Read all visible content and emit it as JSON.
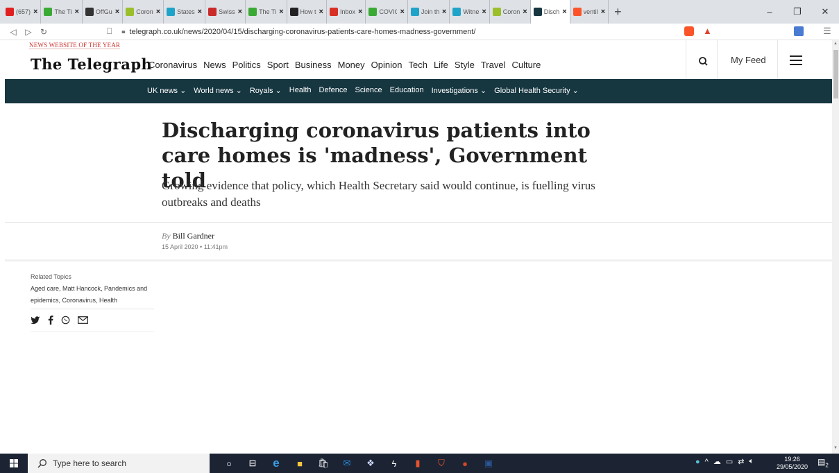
{
  "browser": {
    "tabs": [
      {
        "title": "(657)",
        "icon": "youtube-icon",
        "color": "#e02020"
      },
      {
        "title": "The Ti",
        "icon": "globe-icon",
        "color": "#3aaa35"
      },
      {
        "title": "OffGu",
        "icon": "offguardian-icon",
        "color": "#333333"
      },
      {
        "title": "Coron",
        "icon": "ugtv-icon",
        "color": "#9bbf2a"
      },
      {
        "title": "States",
        "icon": "c-icon",
        "color": "#1fa3c8"
      },
      {
        "title": "Swiss",
        "icon": "swiss-icon",
        "color": "#c92a2a"
      },
      {
        "title": "The Ti",
        "icon": "globe-icon",
        "color": "#3aaa35"
      },
      {
        "title": "How t",
        "icon": "chart-icon",
        "color": "#222222"
      },
      {
        "title": "Inbox",
        "icon": "gmail-icon",
        "color": "#d93025"
      },
      {
        "title": "COVIC",
        "icon": "globe-icon",
        "color": "#3aaa35"
      },
      {
        "title": "Join th",
        "icon": "c-icon",
        "color": "#1fa3c8"
      },
      {
        "title": "Witne",
        "icon": "c-icon",
        "color": "#1fa3c8"
      },
      {
        "title": "Coron",
        "icon": "ugtv-icon",
        "color": "#9bbf2a"
      },
      {
        "title": "Disch",
        "icon": "telegraph-icon",
        "color": "#163640",
        "active": true
      },
      {
        "title": "ventil",
        "icon": "brave-icon",
        "color": "#fb542b"
      }
    ],
    "close_glyph": "×",
    "new_tab": "+",
    "url": "telegraph.co.uk/news/2020/04/15/discharging-coronavirus-patients-care-homes-madness-government/"
  },
  "site": {
    "award": "NEWS WEBSITE OF THE YEAR",
    "logo": "The Telegraph",
    "nav": [
      "Coronavirus",
      "News",
      "Politics",
      "Sport",
      "Business",
      "Money",
      "Opinion",
      "Tech",
      "Life",
      "Style",
      "Travel",
      "Culture"
    ],
    "my_feed": "My Feed",
    "subnav": [
      "UK news ⌄",
      "World news ⌄",
      "Royals ⌄",
      "Health",
      "Defence",
      "Science",
      "Education",
      "Investigations ⌄",
      "Global Health Security ⌄"
    ],
    "subnav_bg": "#163640"
  },
  "article": {
    "headline": "Discharging coronavirus patients into care homes is 'madness', Government told",
    "standfirst": "Growing evidence that policy, which Health Secretary said would continue, is fuelling virus outbreaks and deaths",
    "by": "By",
    "author": "Bill Gardner",
    "date": "15 April 2020 • 11:41pm",
    "related_title": "Related Topics",
    "related_topics": "Aged care, Matt Hancock, Pandemics and epidemics, Coronavirus, Health"
  },
  "taskbar": {
    "search_placeholder": "Type here to search",
    "time": "19:26",
    "date": "29/05/2020",
    "notifications": "2"
  }
}
